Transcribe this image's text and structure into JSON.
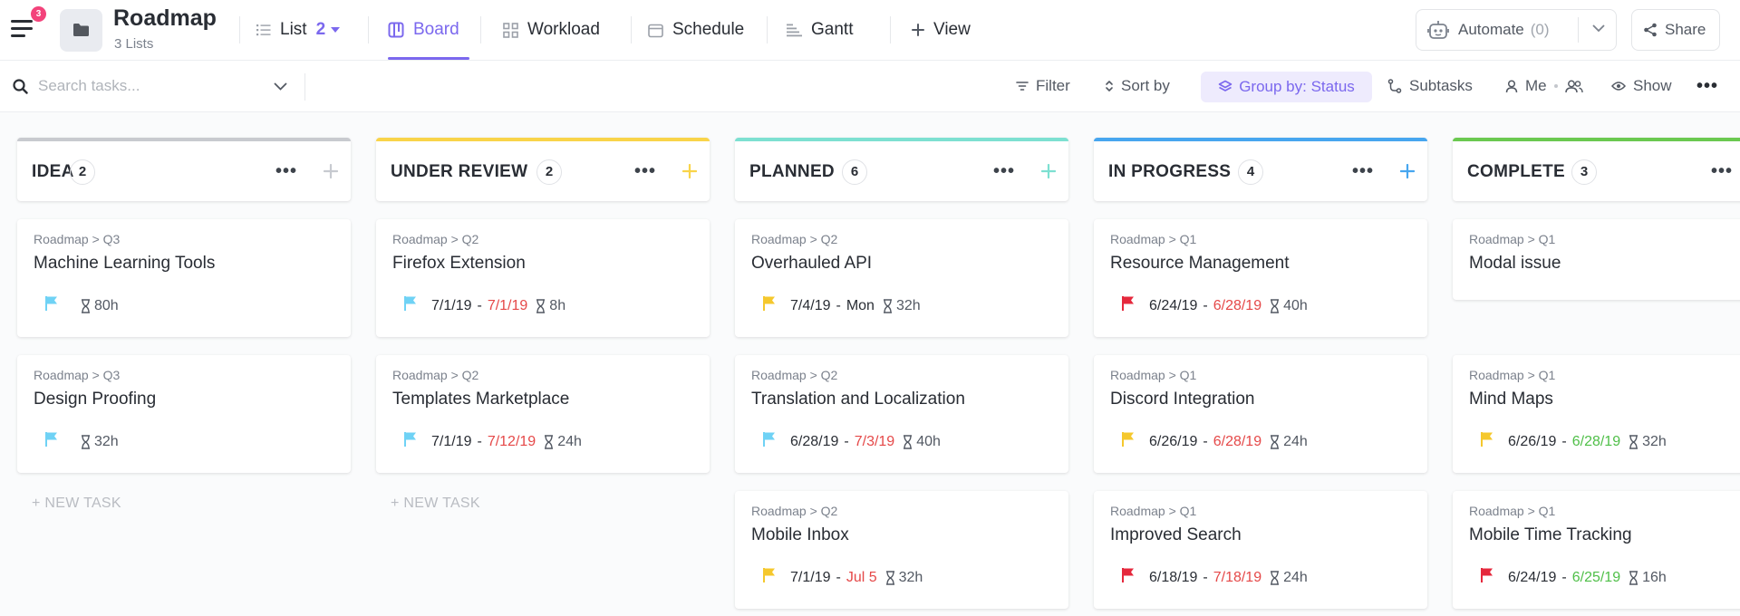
{
  "app": {
    "notification_count": "3"
  },
  "space": {
    "title": "Roadmap",
    "subtitle": "3 Lists"
  },
  "tabs": [
    {
      "label": "List",
      "count": "2"
    },
    {
      "label": "Board"
    },
    {
      "label": "Workload"
    },
    {
      "label": "Schedule"
    },
    {
      "label": "Gantt"
    },
    {
      "label": "View"
    }
  ],
  "actions": {
    "automate_label": "Automate",
    "automate_count": "(0)",
    "share_label": "Share"
  },
  "toolbar": {
    "search_placeholder": "Search tasks...",
    "filter": "Filter",
    "sort": "Sort by",
    "group_by": "Group by: Status",
    "subtasks": "Subtasks",
    "me": "Me",
    "show": "Show"
  },
  "colors": {
    "accent": "#7b68ee",
    "idea": "#c8cacf",
    "under_review": "#f9d44a",
    "planned": "#7de0d1",
    "in_progress": "#47a6ef",
    "complete": "#6bc950",
    "overdue": "#e54848",
    "on_time": "#4fbf48",
    "flag_low": "#6fd2f5",
    "flag_normal": "#f5c82d",
    "flag_urgent": "#e5283c"
  },
  "board": {
    "new_task_label": "+ NEW TASK",
    "columns": [
      {
        "name": "IDEA",
        "count": "2",
        "cards": [
          {
            "breadcrumb": "Roadmap  >  Q3",
            "title": "Machine Learning Tools",
            "flag": "low",
            "start": "",
            "due": "",
            "estimate": "80h"
          },
          {
            "breadcrumb": "Roadmap  >  Q3",
            "title": "Design Proofing",
            "flag": "low",
            "start": "",
            "due": "",
            "estimate": "32h"
          }
        ]
      },
      {
        "name": "UNDER REVIEW",
        "count": "2",
        "cards": [
          {
            "breadcrumb": "Roadmap  >  Q2",
            "title": "Firefox Extension",
            "flag": "low",
            "start": "7/1/19",
            "due": "7/1/19",
            "due_status": "overdue",
            "estimate": "8h"
          },
          {
            "breadcrumb": "Roadmap  >  Q2",
            "title": "Templates Marketplace",
            "flag": "low",
            "start": "7/1/19",
            "due": "7/12/19",
            "due_status": "overdue",
            "estimate": "24h"
          }
        ]
      },
      {
        "name": "PLANNED",
        "count": "6",
        "cards": [
          {
            "breadcrumb": "Roadmap  >  Q2",
            "title": "Overhauled API",
            "flag": "normal",
            "start": "7/4/19",
            "due": "Mon",
            "due_status": "normal",
            "estimate": "32h"
          },
          {
            "breadcrumb": "Roadmap  >  Q2",
            "title": "Translation and Localization",
            "flag": "low",
            "start": "6/28/19",
            "due": "7/3/19",
            "due_status": "overdue",
            "estimate": "40h"
          },
          {
            "breadcrumb": "Roadmap  >  Q2",
            "title": "Mobile Inbox",
            "flag": "normal",
            "start": "7/1/19",
            "due": "Jul 5",
            "due_status": "overdue",
            "estimate": "32h"
          }
        ]
      },
      {
        "name": "IN PROGRESS",
        "count": "4",
        "cards": [
          {
            "breadcrumb": "Roadmap  >  Q1",
            "title": "Resource Management",
            "flag": "urgent",
            "start": "6/24/19",
            "due": "6/28/19",
            "due_status": "overdue",
            "estimate": "40h"
          },
          {
            "breadcrumb": "Roadmap  >  Q1",
            "title": "Discord Integration",
            "flag": "normal",
            "start": "6/26/19",
            "due": "6/28/19",
            "due_status": "overdue",
            "estimate": "24h"
          },
          {
            "breadcrumb": "Roadmap  >  Q1",
            "title": "Improved Search",
            "flag": "urgent",
            "start": "6/18/19",
            "due": "7/18/19",
            "due_status": "overdue",
            "estimate": "24h"
          }
        ]
      },
      {
        "name": "COMPLETE",
        "count": "3",
        "cards": [
          {
            "breadcrumb": "Roadmap  >  Q1",
            "title": "Modal issue",
            "flag": "",
            "start": "",
            "due": "",
            "estimate": ""
          },
          {
            "breadcrumb": "Roadmap  >  Q1",
            "title": "Mind Maps",
            "flag": "normal",
            "start": "6/26/19",
            "due": "6/28/19",
            "due_status": "done",
            "estimate": "32h"
          },
          {
            "breadcrumb": "Roadmap  >  Q1",
            "title": "Mobile Time Tracking",
            "flag": "urgent",
            "start": "6/24/19",
            "due": "6/25/19",
            "due_status": "done",
            "estimate": "16h"
          }
        ]
      }
    ]
  }
}
